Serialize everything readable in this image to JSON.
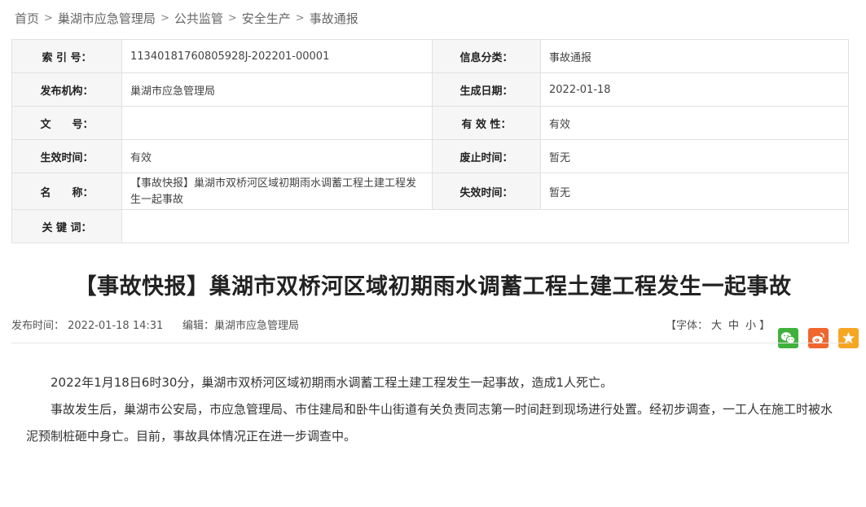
{
  "breadcrumb": {
    "items": [
      "首页",
      "巢湖市应急管理局",
      "公共监管",
      "安全生产",
      "事故通报"
    ],
    "separator": ">"
  },
  "meta": {
    "index_label": "索 引 号：",
    "index_value": "11340181760805928J-202201-00001",
    "category_label": "信息分类：",
    "category_value": "事故通报",
    "publisher_label": "发布机构：",
    "publisher_value": "巢湖市应急管理局",
    "gen_date_label": "生成日期：",
    "gen_date_value": "2022-01-18",
    "doc_no_label": "文　　号：",
    "doc_no_value": "",
    "validity_label": "有 效 性：",
    "validity_value": "有效",
    "effective_label": "生效时间：",
    "effective_value": "有效",
    "abolish_label": "废止时间：",
    "abolish_value": "暂无",
    "name_label": "名　　称：",
    "name_value": "【事故快报】巢湖市双桥河区域初期雨水调蓄工程土建工程发生一起事故",
    "expire_label": "失效时间：",
    "expire_value": "暂无",
    "keywords_label": "关 键 词：",
    "keywords_value": ""
  },
  "article": {
    "title": "【事故快报】巢湖市双桥河区域初期雨水调蓄工程土建工程发生一起事故",
    "publish_time": "发布时间： 2022-01-18 14:31",
    "editor": "编辑：巢湖市应急管理局",
    "font_prefix": "【字体：",
    "font_large": "大",
    "font_medium": "中",
    "font_small": "小",
    "font_suffix": "】",
    "paragraphs": [
      "2022年1月18日6时30分，巢湖市双桥河区域初期雨水调蓄工程土建工程发生一起事故，造成1人死亡。",
      "事故发生后，巢湖市公安局，市应急管理局、市住建局和卧牛山街道有关负责同志第一时间赶到现场进行处置。经初步调查，一工人在施工时被水泥预制桩砸中身亡。目前，事故具体情况正在进一步调查中。"
    ]
  },
  "share": {
    "wechat_icon": "wechat-icon",
    "weibo_icon": "weibo-icon",
    "favorite_icon": "star-icon",
    "colors": {
      "wechat": "#3fb13c",
      "weibo": "#f0662c",
      "favorite": "#f5a623"
    }
  }
}
